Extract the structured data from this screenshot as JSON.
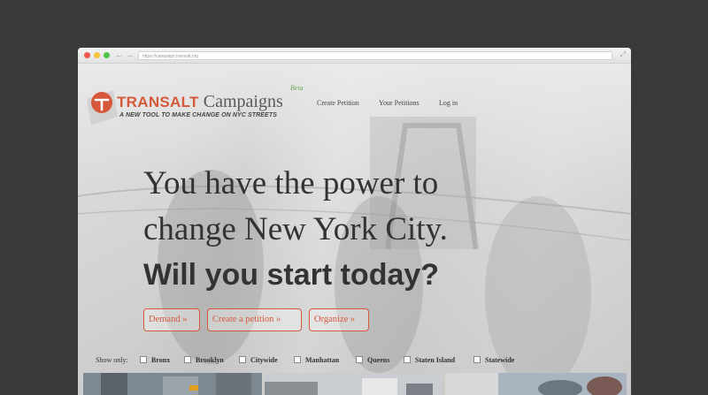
{
  "browser": {
    "url": "https://campaign.transalt.org"
  },
  "header": {
    "brand_primary": "TRANSALT",
    "brand_secondary": "Campaigns",
    "beta_label": "Beta",
    "tagline": "A NEW TOOL TO MAKE CHANGE ON NYC STREETS",
    "nav": [
      "Create Petition",
      "Your Petitions",
      "Log in"
    ]
  },
  "hero": {
    "line1": "You have the power to",
    "line2": "change New York City.",
    "line3": "Will you start today?"
  },
  "actions": [
    "Demand »",
    "Create a petition »",
    "Organize »"
  ],
  "filters": {
    "label": "Show only:",
    "options": [
      "Bronx",
      "Brooklyn",
      "Citywide",
      "Manhattan",
      "Queens",
      "Staten Island",
      "Statewide"
    ]
  },
  "colors": {
    "accent": "#d5593a",
    "beta": "#6aa84f",
    "text": "#333333",
    "backdrop": "#3a3a3a"
  },
  "icons": [
    "transalt-logo-icon",
    "back-arrow-icon",
    "forward-arrow-icon",
    "expand-icon"
  ]
}
